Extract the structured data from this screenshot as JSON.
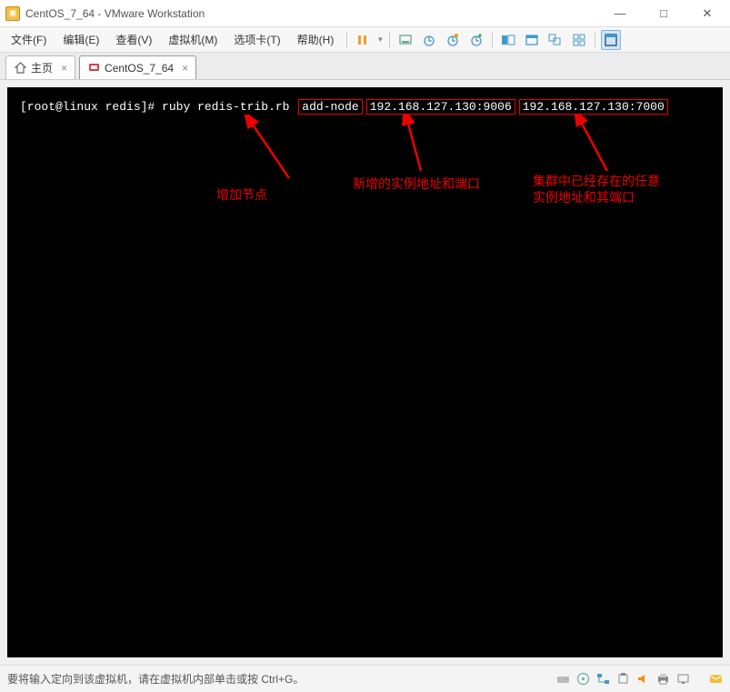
{
  "titlebar": {
    "title": "CentOS_7_64 - VMware Workstation"
  },
  "menu": {
    "file": "文件(F)",
    "edit": "编辑(E)",
    "view": "查看(V)",
    "vm": "虚拟机(M)",
    "tabs": "选项卡(T)",
    "help": "帮助(H)"
  },
  "tabs": {
    "home": "主页",
    "vm": "CentOS_7_64"
  },
  "terminal": {
    "prompt": "[root@linux redis]#",
    "cmd_pre": "ruby redis-trib.rb",
    "box1": "add-node",
    "box2": "192.168.127.130:9006",
    "box3": "192.168.127.130:7000"
  },
  "annotations": {
    "a1": "增加节点",
    "a2": "新增的实例地址和端口",
    "a3_line1": "集群中已经存在的任意",
    "a3_line2": "实例地址和其端口"
  },
  "status": {
    "text": "要将输入定向到该虚拟机，请在虚拟机内部单击或按 Ctrl+G。"
  }
}
